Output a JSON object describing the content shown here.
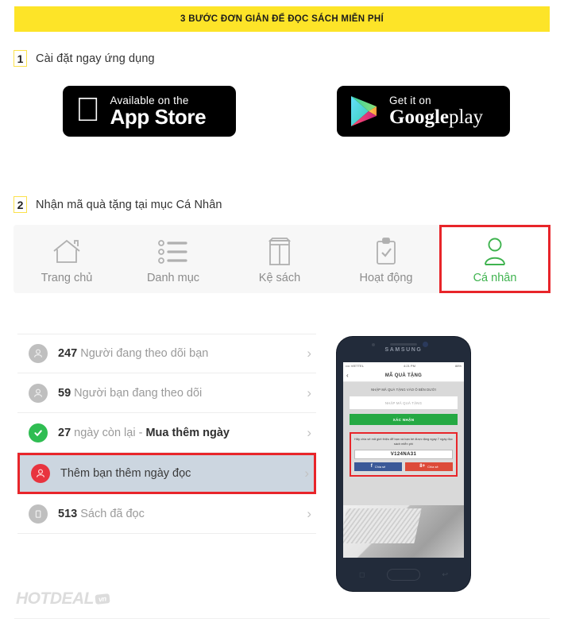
{
  "banner": {
    "title": "3 BƯỚC ĐƠN GIẢN ĐỂ ĐỌC SÁCH MIỄN PHÍ",
    "bg_color": "#fde428"
  },
  "steps": [
    {
      "number": "1",
      "label": "Cài đặt ngay ứng dụng"
    },
    {
      "number": "2",
      "label": "Nhận mã quà tặng tại mục Cá Nhân"
    }
  ],
  "store_badges": {
    "appstore": {
      "small": "Available on the",
      "big": "App Store",
      "icon": "apple-icon"
    },
    "googleplay": {
      "small": "Get it on",
      "big_bold": "Google",
      "big_light": "play",
      "icon": "google-play-triangle-icon"
    }
  },
  "tabbar": {
    "tabs": [
      {
        "label": "Trang chủ",
        "icon": "home-icon",
        "active": false
      },
      {
        "label": "Danh mục",
        "icon": "list-icon",
        "active": false
      },
      {
        "label": "Kệ sách",
        "icon": "book-icon",
        "active": false
      },
      {
        "label": "Hoạt động",
        "icon": "clipboard-check-icon",
        "active": false
      },
      {
        "label": "Cá nhân",
        "icon": "person-icon",
        "active": true
      }
    ],
    "active_color": "#3fb34f",
    "highlight_color": "#e8252a"
  },
  "profile_list": {
    "rows": [
      {
        "count": "247",
        "text": "Người đang theo dõi bạn",
        "icon": "person-circle-icon",
        "icon_color": "#bfbfbf",
        "highlighted": false
      },
      {
        "count": "59",
        "text": "Người bạn đang theo dõi",
        "icon": "person-circle-icon",
        "icon_color": "#bfbfbf",
        "highlighted": false
      },
      {
        "count": "27",
        "text": "ngày còn lại - ",
        "bold_suffix": "Mua thêm ngày",
        "icon": "check-circle-icon",
        "icon_color": "#2fbd52",
        "highlighted": false
      },
      {
        "count": "",
        "text": "Thêm bạn thêm ngày đọc",
        "icon": "person-circle-icon",
        "icon_color": "#e8343f",
        "highlighted": true
      },
      {
        "count": "513",
        "text": "Sách đã đọc",
        "icon": "book-circle-icon",
        "icon_color": "#bfbfbf",
        "highlighted": false
      }
    ],
    "chevron": "›"
  },
  "phone": {
    "brand": "SAMSUNG",
    "status_left": "•••• VIETTEL",
    "status_center": "4:21 PM",
    "status_right": "88%",
    "screen_title": "MÃ QUÀ TẶNG",
    "back_icon": "chevron-left-icon",
    "instruction": "NHẬP MÃ QUÀ TẶNG VÀO Ô BÊN DƯỚI",
    "input_placeholder": "NHẬP MÃ QUÀ TẶNG",
    "confirm_label": "XÁC NHẬN",
    "share_text": "Hãy chia sẻ mã giới thiệu để bạn và bạn bè được tặng ngay 7 ngày đọc sách miễn phí",
    "gift_code": "V124NA31",
    "facebook_share_label": "Chia sẻ",
    "google_share_label": "Chia sẻ",
    "facebook_glyph": "f",
    "google_glyph": "8+"
  },
  "footer": {
    "logo_main": "HOTDEAL",
    "logo_tld": "vn"
  }
}
